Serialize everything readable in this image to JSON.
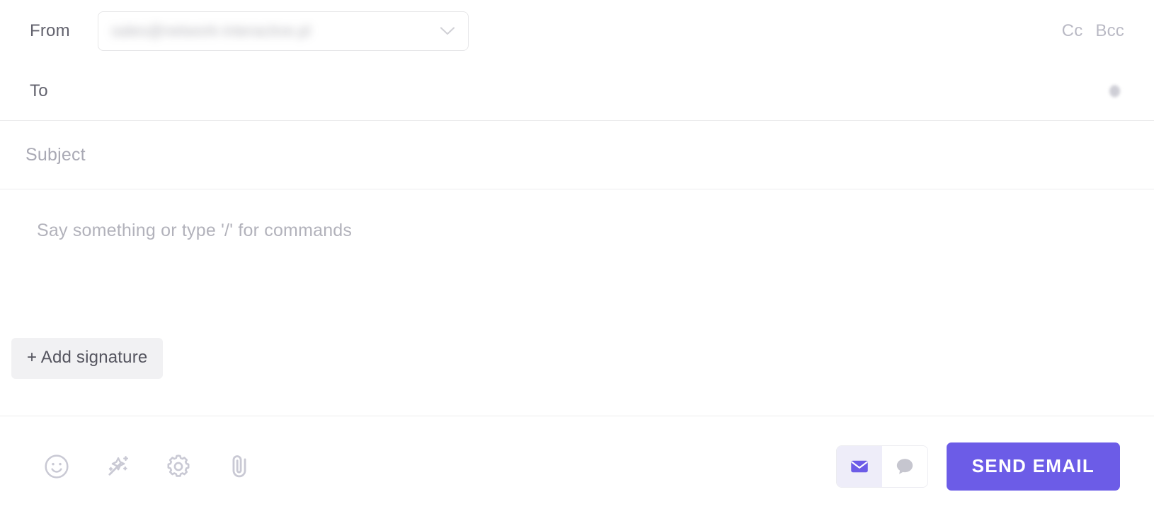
{
  "composer": {
    "from": {
      "label": "From",
      "value": "sales@network-interactive.pl",
      "redacted": true,
      "chevron_icon": "chevron-down-icon"
    },
    "to": {
      "label": "To",
      "value": "",
      "placeholder": "",
      "indicator_icon": "contact-dot-icon"
    },
    "cc_label": "Cc",
    "bcc_label": "Bcc",
    "subject": {
      "value": "",
      "placeholder": "Subject"
    },
    "body": {
      "value": "",
      "placeholder": "Say something or type '/' for commands"
    },
    "signature_button_label": "+ Add signature",
    "toolbar": {
      "icons": [
        {
          "name": "emoji-icon",
          "title": "Emoji"
        },
        {
          "name": "magic-wand-icon",
          "title": "AI assist"
        },
        {
          "name": "gear-icon",
          "title": "Settings"
        },
        {
          "name": "paperclip-icon",
          "title": "Attach file"
        }
      ]
    },
    "mode_toggle": {
      "options": [
        {
          "name": "email-mode",
          "icon": "envelope-icon",
          "active": true
        },
        {
          "name": "chat-mode",
          "icon": "chat-bubble-icon",
          "active": false
        }
      ]
    },
    "send_button_label": "SEND EMAIL"
  },
  "colors": {
    "accent_purple": "#6c5ce7",
    "toggle_active_bg": "#eeedf9",
    "icon_gray": "#c9c9d4",
    "divider": "#ececed",
    "label_gray": "#62626d",
    "placeholder_gray": "#b2b2bb",
    "signature_bg": "#f1f1f3"
  }
}
